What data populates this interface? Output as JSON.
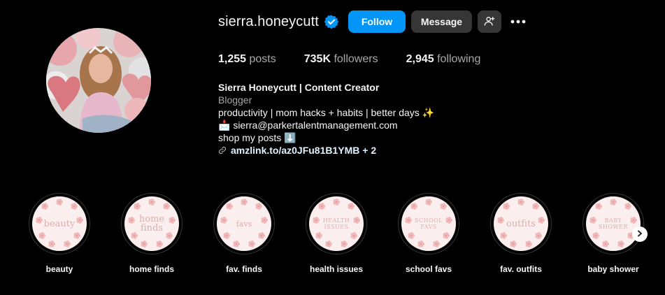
{
  "profile": {
    "username": "sierra.honeycutt",
    "verified": true,
    "follow_label": "Follow",
    "message_label": "Message",
    "more_icon": "more-dots-icon",
    "adduser_icon": "add-user-icon"
  },
  "stats": {
    "posts_value": "1,255",
    "posts_label": "posts",
    "followers_value": "735K",
    "followers_label": "followers",
    "following_value": "2,945",
    "following_label": "following"
  },
  "bio": {
    "name": "Sierra Honeycutt | Content Creator",
    "category": "Blogger",
    "line1": "productivity | mom hacks + habits | better days ✨",
    "email": "📩 sierra@parkertalentmanagement.com",
    "shop": "shop my posts ⬇️",
    "link": "amzlink.to/az0JFu81B1YMB + 2"
  },
  "highlights": [
    {
      "label": "beauty",
      "cover": "beauty"
    },
    {
      "label": "home finds",
      "cover": "home\nfinds"
    },
    {
      "label": "fav. finds",
      "cover": "favs"
    },
    {
      "label": "health issues",
      "cover": "HEALTH\nISSUES"
    },
    {
      "label": "school favs",
      "cover": "SCHOOL\nFAVS"
    },
    {
      "label": "fav. outfits",
      "cover": "outfits"
    },
    {
      "label": "baby shower",
      "cover": "BABY\nSHOWER"
    }
  ],
  "colors": {
    "accent": "#0095f6",
    "button_dark": "#363636",
    "highlight_bg": "#fbeeee",
    "highlight_text": "#d9b0ad"
  }
}
